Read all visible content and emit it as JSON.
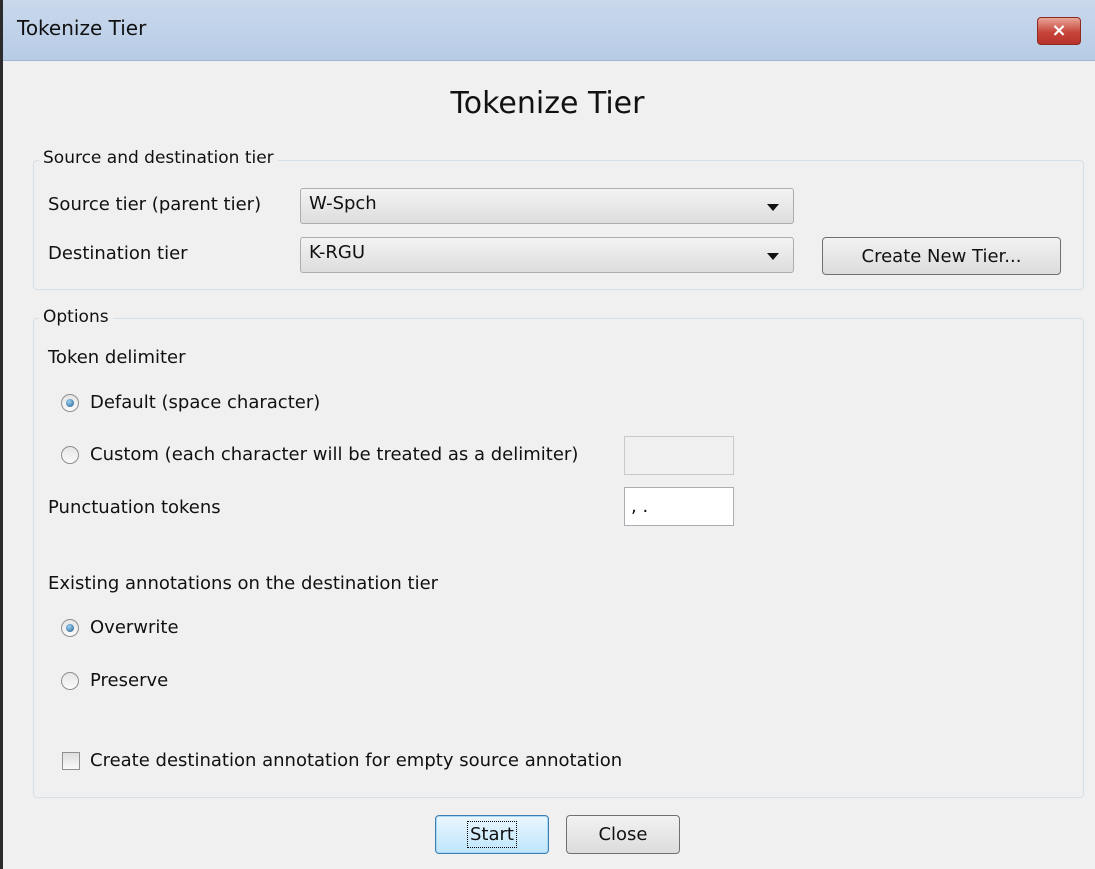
{
  "window": {
    "title": "Tokenize Tier",
    "close_glyph": "×"
  },
  "heading": "Tokenize Tier",
  "source_dest": {
    "legend": "Source and destination tier",
    "source_label": "Source tier (parent tier)",
    "source_value": "W-Spch",
    "dest_label": "Destination tier",
    "dest_value": "K-RGU",
    "create_button": "Create New Tier..."
  },
  "options": {
    "legend": "Options",
    "token_delimiter_label": "Token delimiter",
    "default_radio": {
      "label": "Default (space character)",
      "checked": true
    },
    "custom_radio": {
      "label": "Custom (each character will be treated as a delimiter)",
      "checked": false
    },
    "custom_value": "",
    "punctuation_label": "Punctuation tokens",
    "punctuation_value": ", .",
    "existing_label": "Existing annotations on the destination tier",
    "overwrite_radio": {
      "label": "Overwrite",
      "checked": true
    },
    "preserve_radio": {
      "label": "Preserve",
      "checked": false
    },
    "empty_checkbox": {
      "label": "Create destination annotation for empty source annotation",
      "checked": false
    }
  },
  "buttons": {
    "start": "Start",
    "close": "Close"
  }
}
